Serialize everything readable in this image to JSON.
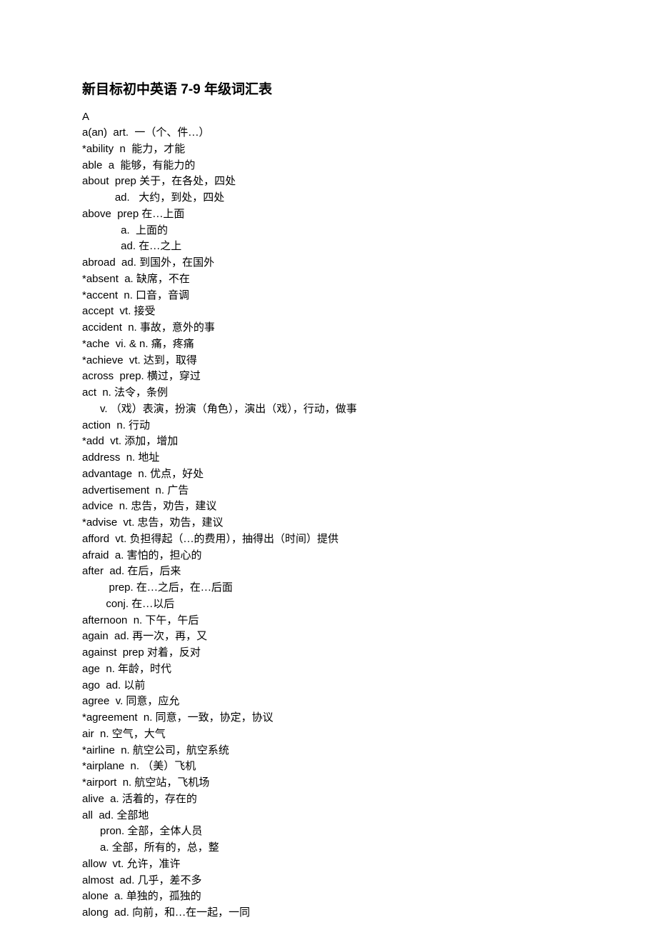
{
  "title": "新目标初中英语 7-9 年级词汇表",
  "section": "A",
  "entries": [
    {
      "word": "a(an)  art.  ",
      "def": "一（个、件…）"
    },
    {
      "word": "*ability  n  ",
      "def": "能力，才能"
    },
    {
      "word": "able  a  ",
      "def": "能够，有能力的"
    },
    {
      "word": "about  prep ",
      "def": "关于，在各处，四处"
    },
    {
      "word": "           ad.   ",
      "def": "大约，到处，四处"
    },
    {
      "word": "above  prep ",
      "def": "在…上面"
    },
    {
      "word": "             a.  ",
      "def": "上面的"
    },
    {
      "word": "             ad. ",
      "def": "在…之上"
    },
    {
      "word": "abroad  ad. ",
      "def": "到国外，在国外"
    },
    {
      "word": "*absent  a. ",
      "def": "缺席，不在"
    },
    {
      "word": "*accent  n. ",
      "def": "口音，音调"
    },
    {
      "word": "accept  vt. ",
      "def": "接受"
    },
    {
      "word": "accident  n. ",
      "def": "事故，意外的事"
    },
    {
      "word": "*ache  vi. & n. ",
      "def": "痛，疼痛"
    },
    {
      "word": "*achieve  vt. ",
      "def": "达到，取得"
    },
    {
      "word": "across  prep. ",
      "def": "横过，穿过"
    },
    {
      "word": "act  n. ",
      "def": "法令，条例"
    },
    {
      "word": "      v. ",
      "def": "（戏）表演，扮演（角色），演出（戏），行动，做事"
    },
    {
      "word": "action  n. ",
      "def": "行动"
    },
    {
      "word": "*add  vt. ",
      "def": "添加，增加"
    },
    {
      "word": "address  n. ",
      "def": "地址"
    },
    {
      "word": "advantage  n. ",
      "def": "优点，好处"
    },
    {
      "word": "advertisement  n. ",
      "def": "广告"
    },
    {
      "word": "advice  n. ",
      "def": "忠告，劝告，建议"
    },
    {
      "word": "*advise  vt. ",
      "def": "忠告，劝告，建议"
    },
    {
      "word": "afford  vt. ",
      "def": "负担得起（…的费用），抽得出（时间）提供"
    },
    {
      "word": "afraid  a. ",
      "def": "害怕的，担心的"
    },
    {
      "word": "after  ad. ",
      "def": "在后，后来"
    },
    {
      "word": "         prep. ",
      "def": "在…之后，在…后面"
    },
    {
      "word": "        conj. ",
      "def": "在…以后"
    },
    {
      "word": "afternoon  n. ",
      "def": "下午，午后"
    },
    {
      "word": "again  ad. ",
      "def": "再一次，再，又"
    },
    {
      "word": "against  prep ",
      "def": "对着，反对"
    },
    {
      "word": "age  n. ",
      "def": "年龄，时代"
    },
    {
      "word": "ago  ad. ",
      "def": "以前"
    },
    {
      "word": "agree  v. ",
      "def": "同意，应允"
    },
    {
      "word": "*agreement  n. ",
      "def": "同意，一致，协定，协议"
    },
    {
      "word": "air  n. ",
      "def": "空气，大气"
    },
    {
      "word": "*airline  n. ",
      "def": "航空公司，航空系统"
    },
    {
      "word": "*airplane  n. ",
      "def": "（美）飞机"
    },
    {
      "word": "*airport  n. ",
      "def": "航空站，飞机场"
    },
    {
      "word": "alive  a. ",
      "def": "活着的，存在的"
    },
    {
      "word": "all  ad. ",
      "def": "全部地"
    },
    {
      "word": "      pron. ",
      "def": "全部，全体人员"
    },
    {
      "word": "      a. ",
      "def": "全部，所有的，总，整"
    },
    {
      "word": "allow  vt. ",
      "def": "允许，准许"
    },
    {
      "word": "almost  ad. ",
      "def": "几乎，差不多"
    },
    {
      "word": "alone  a. ",
      "def": "单独的，孤独的"
    },
    {
      "word": "along  ad. ",
      "def": "向前，和…在一起，一同"
    }
  ]
}
